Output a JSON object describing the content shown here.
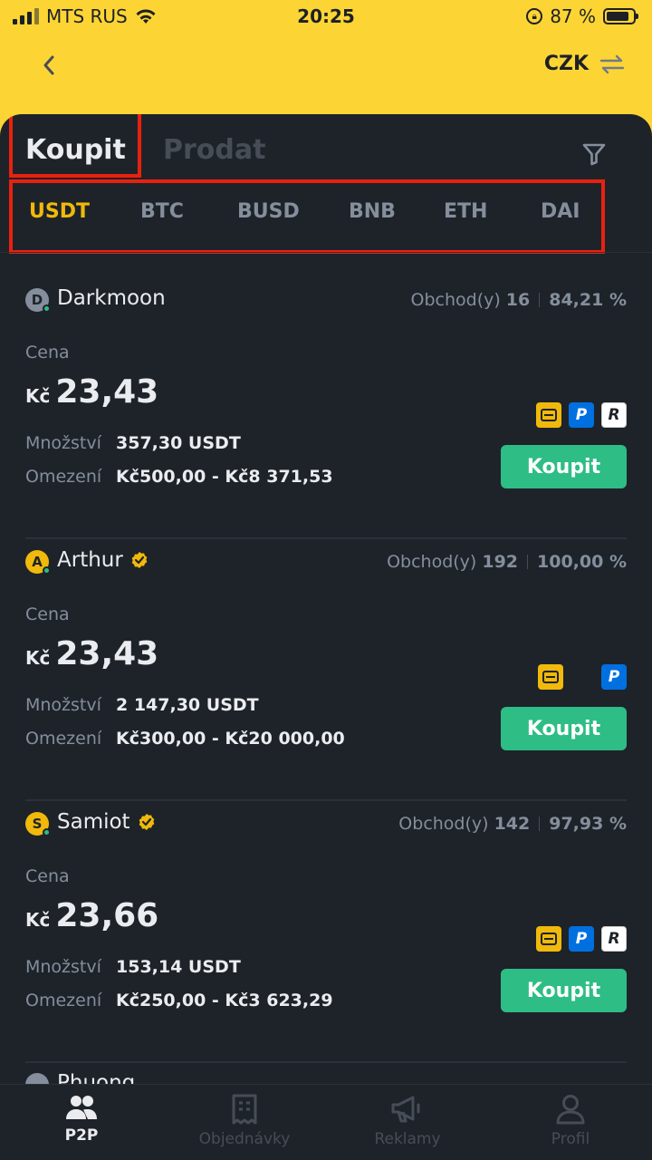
{
  "status_bar": {
    "carrier": "MTS RUS",
    "time": "20:25",
    "battery": "87 %"
  },
  "header": {
    "currency": "CZK"
  },
  "tabs": {
    "buy": "Koupit",
    "sell": "Prodat"
  },
  "coins": [
    "USDT",
    "BTC",
    "BUSD",
    "BNB",
    "ETH",
    "DAI"
  ],
  "labels": {
    "price": "Cena",
    "amount": "Množství",
    "limit": "Omezení",
    "trades": "Obchod(y)",
    "buy_button": "Koupit",
    "currency_symbol": "Kč"
  },
  "ads": [
    {
      "initial": "D",
      "name": "Darkmoon",
      "verified": false,
      "avatar_color": "#848E9C",
      "trades": "16",
      "completion": "84,21 %",
      "price": "23,43",
      "amount": "357,30  USDT",
      "limit": "Kč500,00 - Kč8 371,53",
      "payments": [
        "bank-card-icon",
        "paypal-icon",
        "revolut-icon"
      ]
    },
    {
      "initial": "A",
      "name": "Arthur",
      "verified": true,
      "avatar_color": "#F0B90B",
      "trades": "192",
      "completion": "100,00 %",
      "price": "23,43",
      "amount": "2 147,30  USDT",
      "limit": "Kč300,00 - Kč20 000,00",
      "payments": [
        "bank-card-icon",
        "paypal-icon"
      ]
    },
    {
      "initial": "S",
      "name": "Samiot",
      "verified": true,
      "avatar_color": "#F0B90B",
      "trades": "142",
      "completion": "97,93 %",
      "price": "23,66",
      "amount": "153,14  USDT",
      "limit": "Kč250,00 - Kč3 623,29",
      "payments": [
        "bank-card-icon",
        "paypal-icon",
        "revolut-icon"
      ]
    }
  ],
  "partial_ad": {
    "name": "Phuong"
  },
  "nav": [
    {
      "label": "P2P",
      "icon": "p2p-users-icon",
      "active": true
    },
    {
      "label": "Objednávky",
      "icon": "orders-icon",
      "active": false
    },
    {
      "label": "Reklamy",
      "icon": "megaphone-icon",
      "active": false
    },
    {
      "label": "Profil",
      "icon": "profile-icon",
      "active": false
    }
  ]
}
